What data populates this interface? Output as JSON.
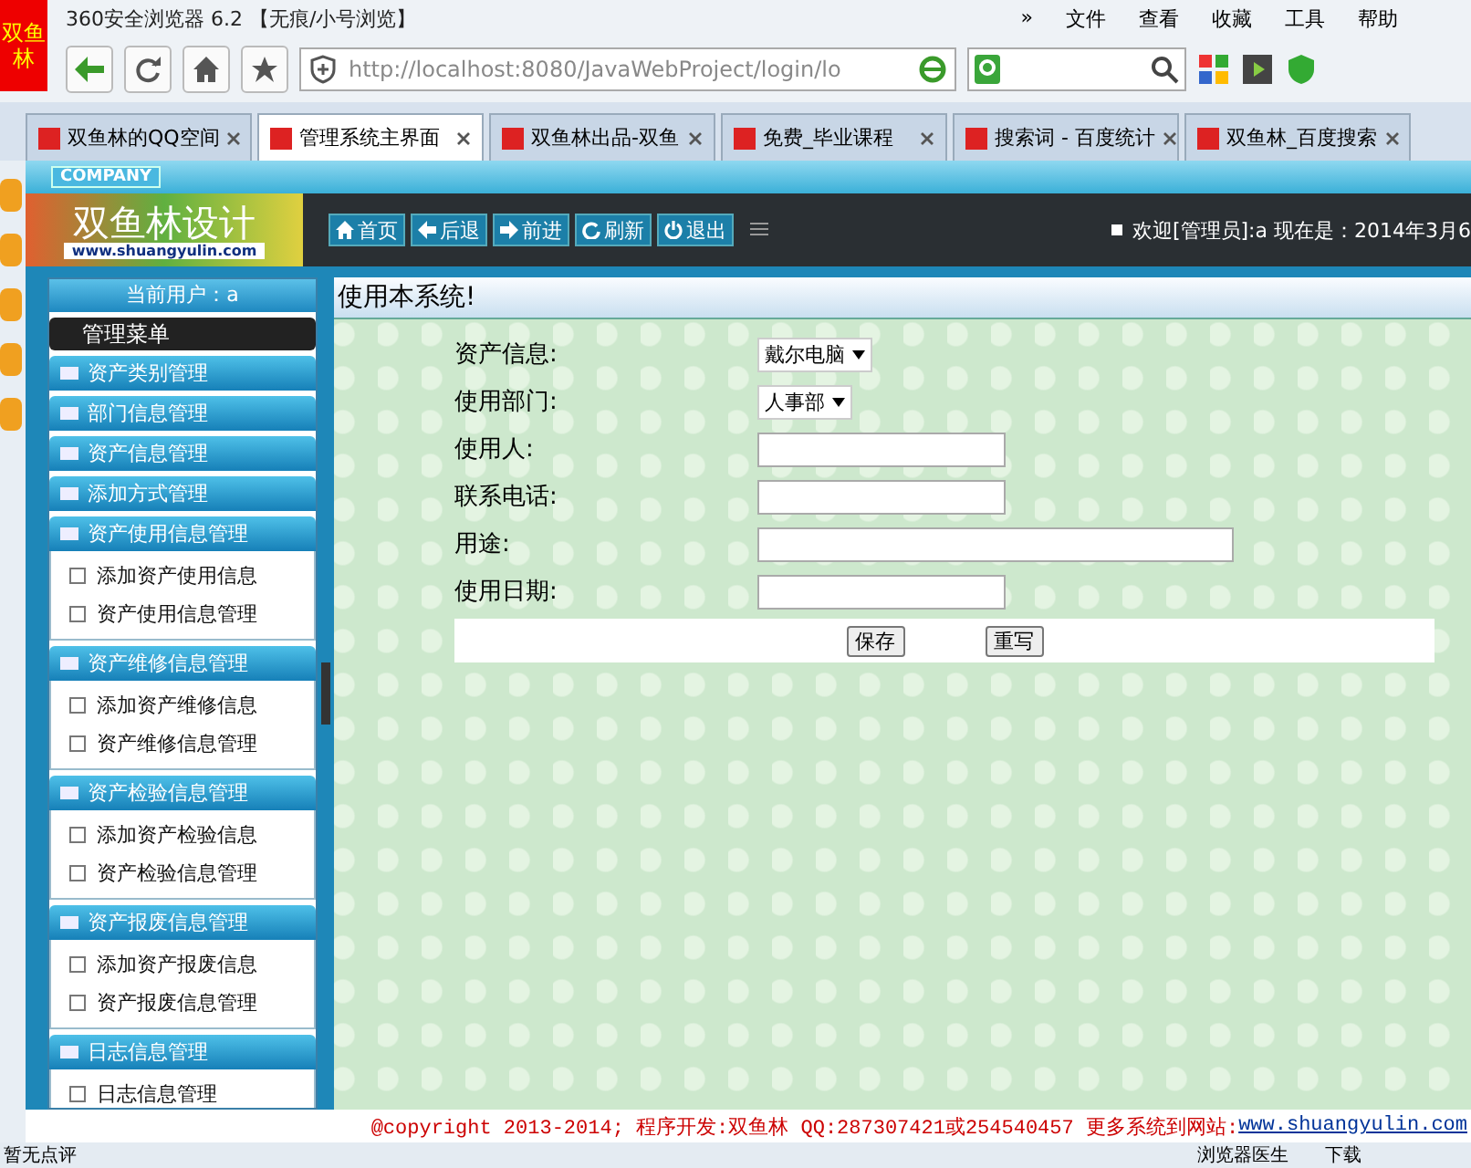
{
  "browser": {
    "logo": [
      "双",
      "鱼",
      "林"
    ],
    "title": "360安全浏览器 6.2 【无痕/小号浏览】",
    "menu": [
      "»",
      "文件",
      "查看",
      "收藏",
      "工具",
      "帮助"
    ],
    "url": "http://localhost:8080/JavaWebProject/login/lo",
    "tabs": [
      {
        "label": "双鱼林的QQ空间",
        "selected": false
      },
      {
        "label": "管理系统主界面",
        "selected": true
      },
      {
        "label": "双鱼林出品-双鱼",
        "selected": false
      },
      {
        "label": "免费_毕业课程",
        "selected": false
      },
      {
        "label": "搜索词 - 百度统计",
        "selected": false
      },
      {
        "label": "双鱼林_百度搜索",
        "selected": false
      }
    ],
    "status_left": "暂无点评",
    "status_items": [
      "浏览器医生",
      "下载"
    ]
  },
  "header": {
    "company": "COMPANY",
    "logo_title": "双鱼林设计",
    "logo_url": "www.shuangyulin.com",
    "nav": [
      "首页",
      "后退",
      "前进",
      "刷新",
      "退出"
    ],
    "welcome": "欢迎[管理员]:a 现在是：2014年3月6"
  },
  "sidebar": {
    "current_user": "当前用户：a",
    "menu_title": "管理菜单",
    "groups": [
      {
        "title": "资产类别管理",
        "expanded": false
      },
      {
        "title": "部门信息管理",
        "expanded": false
      },
      {
        "title": "资产信息管理",
        "expanded": false
      },
      {
        "title": "添加方式管理",
        "expanded": false
      },
      {
        "title": "资产使用信息管理",
        "expanded": true,
        "children": [
          "添加资产使用信息",
          "资产使用信息管理"
        ]
      },
      {
        "title": "资产维修信息管理",
        "expanded": true,
        "children": [
          "添加资产维修信息",
          "资产维修信息管理"
        ]
      },
      {
        "title": "资产检验信息管理",
        "expanded": true,
        "children": [
          "添加资产检验信息",
          "资产检验信息管理"
        ]
      },
      {
        "title": "资产报废信息管理",
        "expanded": true,
        "children": [
          "添加资产报废信息",
          "资产报废信息管理"
        ]
      },
      {
        "title": "日志信息管理",
        "expanded": true,
        "children": [
          "日志信息管理"
        ]
      }
    ]
  },
  "content": {
    "title": "使用本系统!",
    "fields": [
      {
        "kind": "select",
        "label": "资产信息:",
        "value": "戴尔电脑"
      },
      {
        "kind": "select",
        "label": "使用部门:",
        "value": "人事部"
      },
      {
        "kind": "text",
        "label": "使用人:"
      },
      {
        "kind": "text",
        "label": "联系电话:"
      },
      {
        "kind": "longtext",
        "label": "用途:"
      },
      {
        "kind": "text",
        "label": "使用日期:"
      }
    ],
    "buttons": [
      "保存",
      "重写"
    ]
  },
  "footer": {
    "text": "@copyright 2013-2014; 程序开发:双鱼林  QQ:287307421或254540457  更多系统到网站: ",
    "link": "www.shuangyulin.com"
  }
}
